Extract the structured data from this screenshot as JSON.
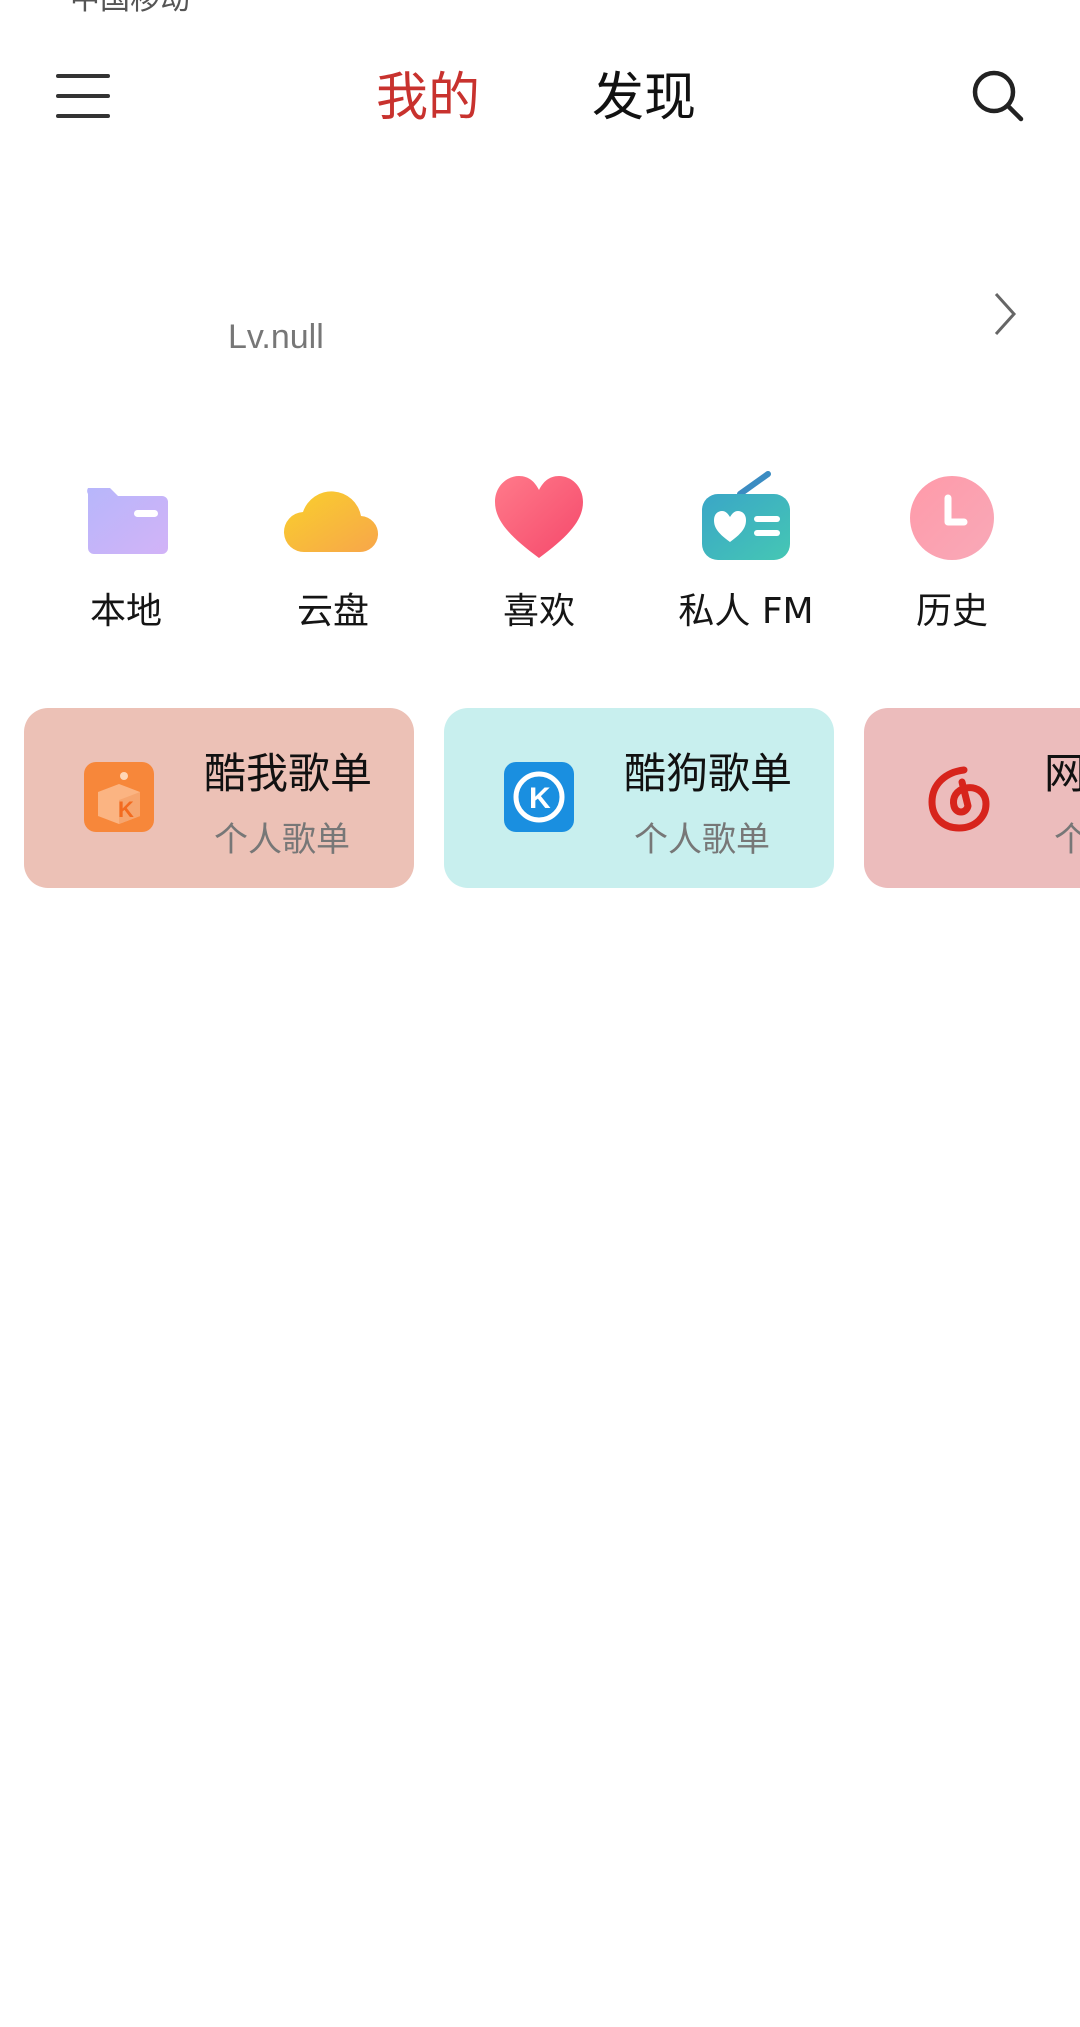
{
  "status_bar": {
    "partial_text": "中国移动"
  },
  "header": {
    "tabs": [
      {
        "label": "我的",
        "active": true
      },
      {
        "label": "发现",
        "active": false
      }
    ]
  },
  "profile": {
    "level": "Lv.null"
  },
  "shortcuts": [
    {
      "label": "本地",
      "icon": "folder-icon"
    },
    {
      "label": "云盘",
      "icon": "cloud-icon"
    },
    {
      "label": "喜欢",
      "icon": "heart-icon"
    },
    {
      "label": "私人 FM",
      "icon": "radio-icon"
    },
    {
      "label": "历史",
      "icon": "clock-icon"
    }
  ],
  "playlist_cards": [
    {
      "title": "酷我歌单",
      "subtitle": "个人歌单",
      "icon": "kuwo-logo-icon",
      "bg": "#ecc1b6"
    },
    {
      "title": "酷狗歌单",
      "subtitle": "个人歌单",
      "icon": "kugou-logo-icon",
      "bg": "#c8efee"
    },
    {
      "title": "网易云歌单",
      "subtitle": "个人歌单",
      "icon": "netease-logo-icon",
      "bg": "#ecbcbc"
    }
  ],
  "colors": {
    "accent": "#c8322e",
    "text_primary": "#111111",
    "text_secondary": "#777777"
  }
}
